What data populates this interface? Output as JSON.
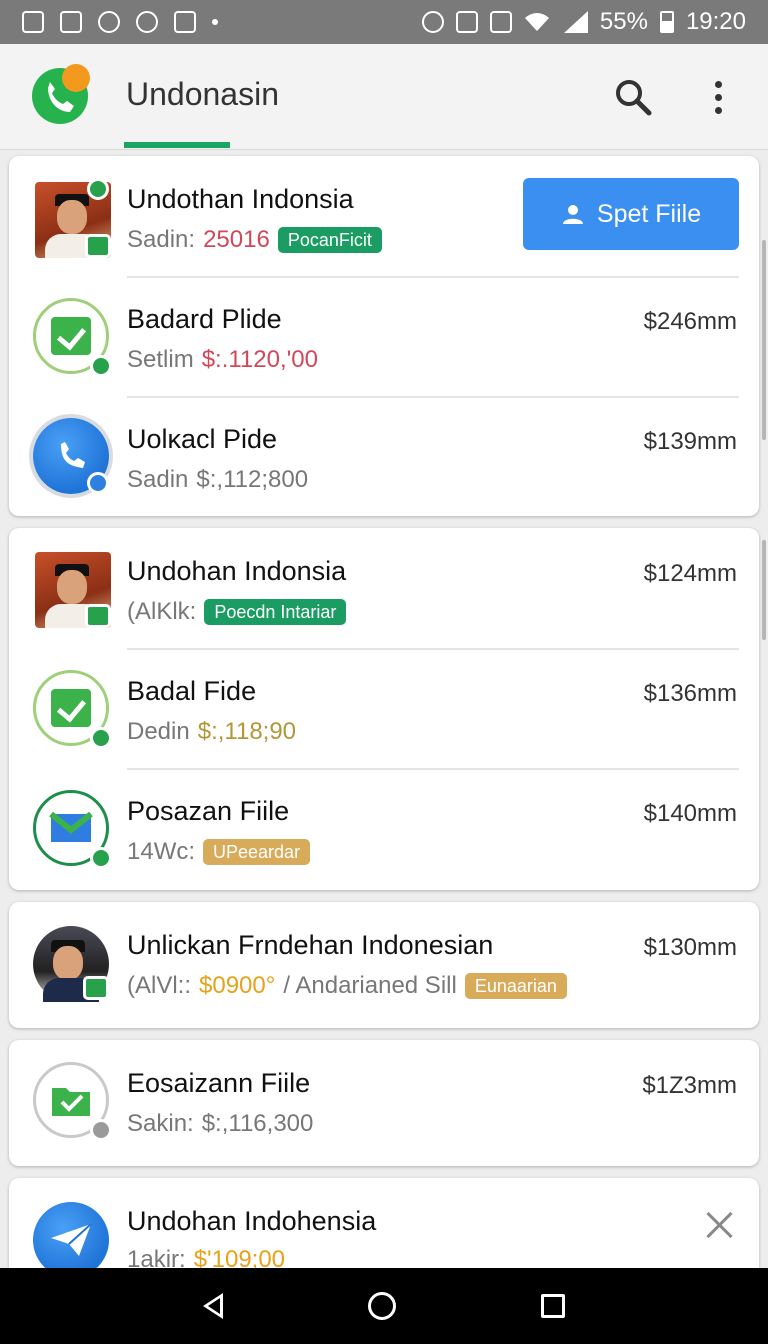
{
  "status_bar": {
    "battery": "55%",
    "time": "19:20"
  },
  "app_bar": {
    "title": "Undonasin"
  },
  "cards": [
    {
      "rows": [
        {
          "title": "Undothan Indonsia",
          "sub_label": "Sadin:",
          "sub_value": "25016",
          "tag": "PocanFicit",
          "button": "Spet Fiile"
        },
        {
          "title": "Badard Plide",
          "sub_label": "Setlim",
          "sub_value": "$:.1120,'00",
          "amount": "$246mm"
        },
        {
          "title": "Uolĸacl Pide",
          "sub_label": "Sadin",
          "sub_value": "$:,112;800",
          "amount": "$139mm"
        }
      ]
    },
    {
      "rows": [
        {
          "title": "Undohan Indonsia",
          "sub_label": "(AlKlk:",
          "tag": "Poecdn Intariar",
          "amount": "$124mm"
        },
        {
          "title": "Badal Fide",
          "sub_label": "Dedin",
          "sub_value": "$:,118;90",
          "amount": "$136mm"
        },
        {
          "title": "Posazan Fiile",
          "sub_label": "14Wc:",
          "tag": "UPeeardar",
          "amount": "$140mm"
        }
      ]
    },
    {
      "rows": [
        {
          "title": "Unlickan Frndehan Indonesian",
          "sub_label": "(AlVl::",
          "sub_value": "$0900°",
          "sub_extra": "/ Andarianed Sill",
          "tag": "Eunaarian",
          "amount": "$130mm"
        }
      ]
    },
    {
      "rows": [
        {
          "title": "Eosaizann Fiile",
          "sub_label": "Sakin:",
          "sub_value": "$:,116,300",
          "amount": "$1Z3mm"
        }
      ]
    },
    {
      "rows": [
        {
          "title": "Undohan Indohensia",
          "sub_label": "1akir:",
          "sub_value": "$'109;00"
        }
      ]
    }
  ]
}
